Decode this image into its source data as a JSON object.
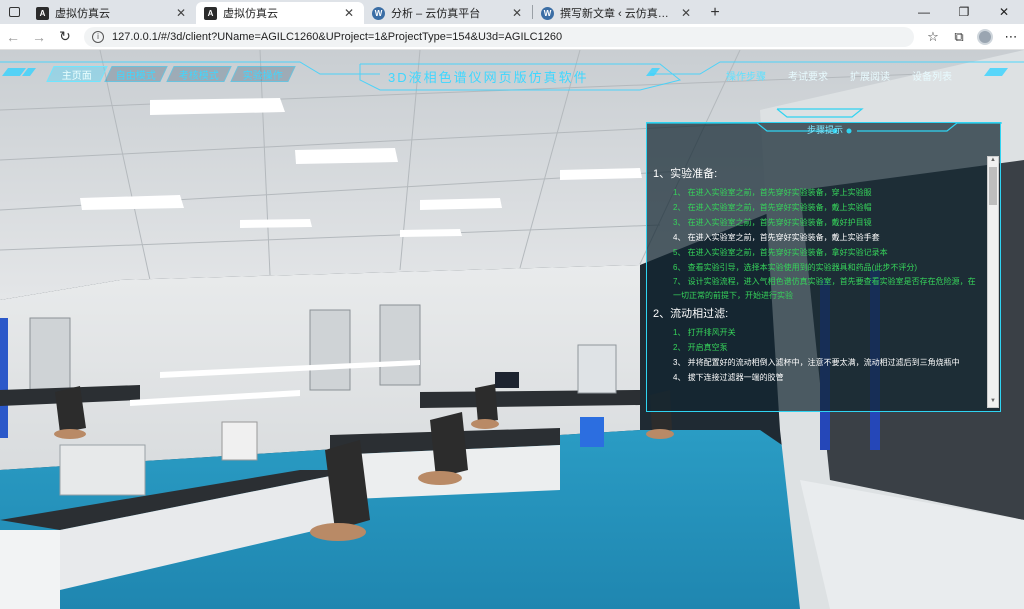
{
  "browser": {
    "tabs": [
      {
        "label": "虚拟仿真云",
        "icon": "angular-icon",
        "active": false
      },
      {
        "label": "虚拟仿真云",
        "icon": "angular-icon",
        "active": true
      },
      {
        "label": "分析 – 云仿真平台",
        "icon": "wordpress-icon",
        "active": false
      },
      {
        "label": "撰写新文章 ‹ 云仿真平台 — Wo",
        "icon": "wordpress-icon",
        "active": false
      }
    ],
    "url": "127.0.0.1/#/3d/client?UName=AGILC1260&UProject=1&ProjectType=154&U3d=AGILC1260"
  },
  "hud": {
    "left_menu": [
      "主页面",
      "自由模式",
      "考核模式",
      "实验操作"
    ],
    "title": "3D液相色谱仪网页版仿真软件",
    "right_menu": [
      "操作步骤",
      "考试要求",
      "扩展阅读",
      "设备列表"
    ]
  },
  "panel": {
    "title": "步骤提示",
    "sections": [
      {
        "title": "1、实验准备:",
        "steps": [
          {
            "text": "1、 在进入实验室之前，首先穿好实验装备，穿上实验服",
            "color": "green"
          },
          {
            "text": "2、 在进入实验室之前，首先穿好实验装备，戴上实验帽",
            "color": "green"
          },
          {
            "text": "3、 在进入实验室之前，首先穿好实验装备，戴好护目镜",
            "color": "green"
          },
          {
            "text": "4、 在进入实验室之前，首先穿好实验装备，戴上实验手套",
            "color": "white"
          },
          {
            "text": "5、 在进入实验室之前，首先穿好实验装备，拿好实验记录本",
            "color": "green"
          },
          {
            "text": "6、 查看实验引导，选择本实验使用到的实验器具和药品(此步不评分)",
            "color": "green"
          },
          {
            "text": "7、 设计实验流程，进入气相色谱仿真实验室，首先要查看实验室是否存在危险源，在一切正常的前提下，开始进行实验",
            "color": "green"
          }
        ]
      },
      {
        "title": "2、流动相过滤:",
        "steps": [
          {
            "text": "1、 打开排风开关",
            "color": "green"
          },
          {
            "text": "2、 开启真空泵",
            "color": "green"
          },
          {
            "text": "3、 并将配置好的流动相倒入滤杯中，注意不要太满，流动相过滤后到三角烧瓶中",
            "color": "white"
          },
          {
            "text": "4、 拔下连接过滤器一端的胶管",
            "color": "white"
          }
        ]
      }
    ]
  }
}
